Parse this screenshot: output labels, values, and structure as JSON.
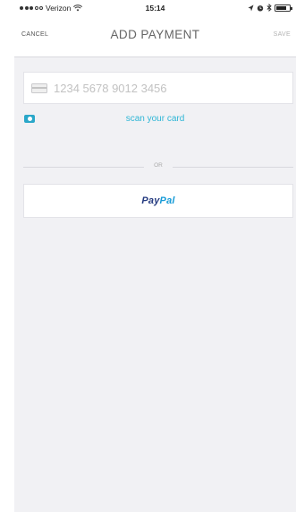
{
  "status_bar": {
    "carrier": "Verizon",
    "time": "15:14",
    "battery_level": 0.8
  },
  "nav": {
    "cancel_label": "CANCEL",
    "title": "ADD PAYMENT",
    "save_label": "SAVE"
  },
  "card_field": {
    "placeholder": "1234 5678 9012 3456",
    "value": ""
  },
  "scan": {
    "label": "scan your card"
  },
  "divider": {
    "label": "OR"
  },
  "paypal": {
    "logo_part1": "Pay",
    "logo_part2": "Pal",
    "colors": {
      "dark": "#253b80",
      "light": "#179bd7"
    }
  },
  "colors": {
    "accent": "#2fb6d6",
    "background": "#f1f1f4"
  },
  "icons": [
    "signal-dots-icon",
    "wifi-icon",
    "location-icon",
    "alarm-icon",
    "bluetooth-icon",
    "battery-icon",
    "credit-card-icon",
    "camera-icon"
  ]
}
